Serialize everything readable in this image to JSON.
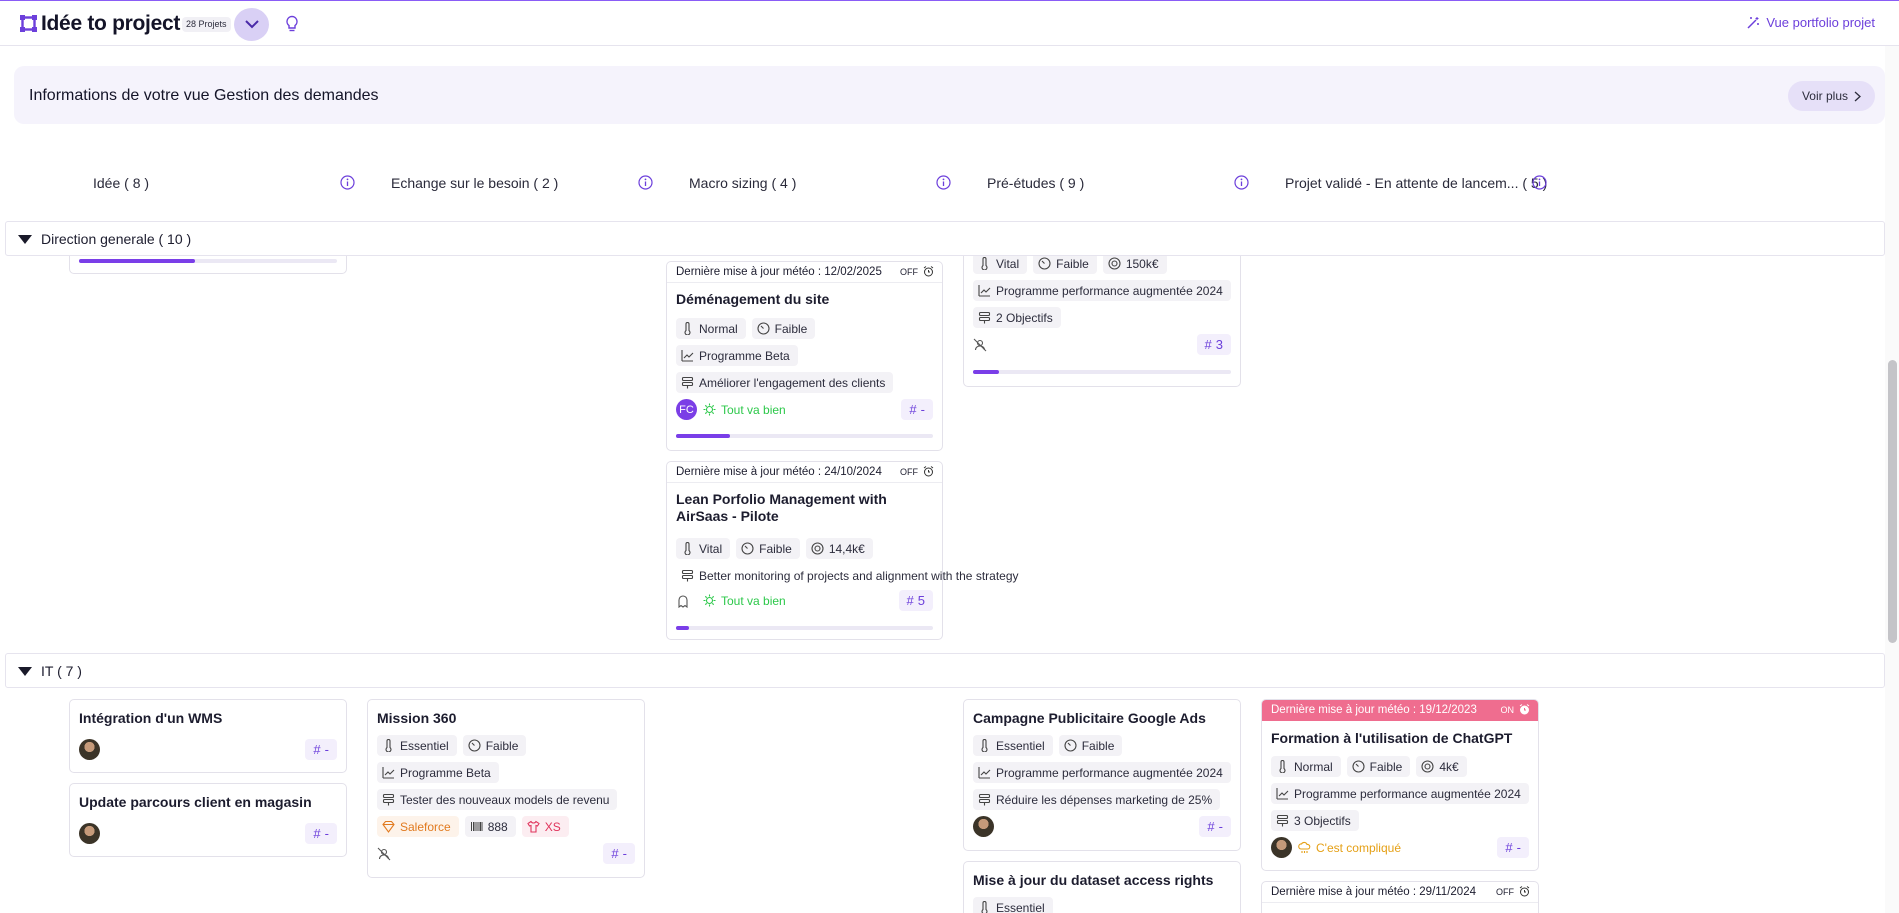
{
  "app": {
    "title": "Idée to project",
    "projects_count": "28 Projets",
    "portfolio_link": "Vue portfolio projet"
  },
  "banner": {
    "title": "Informations de votre vue Gestion des demandes",
    "more": "Voir plus"
  },
  "columns": [
    {
      "title": "Idée ( 8 )"
    },
    {
      "title": "Echange sur le besoin ( 2 )"
    },
    {
      "title": "Macro sizing ( 4 )"
    },
    {
      "title": "Pré-études ( 9 )"
    },
    {
      "title": "Projet validé - En attente de lancem... ( 5 )"
    }
  ],
  "groups": [
    {
      "label": "Direction generale ( 10 )"
    },
    {
      "label": "IT ( 7 )"
    }
  ],
  "cards": {
    "demenagement": {
      "meteo": "Dernière mise à jour météo : 12/02/2025",
      "toggle": "OFF",
      "title": "Déménagement du site",
      "tags": [
        "Normal",
        "Faible"
      ],
      "program": "Programme Beta",
      "objective": "Améliorer l'engagement des clients",
      "owner": "FC",
      "mood": "Tout va bien",
      "hash": "-",
      "progress": 0.21
    },
    "lean": {
      "meteo": "Dernière mise à jour météo : 24/10/2024",
      "toggle": "OFF",
      "title": "Lean Porfolio Management with AirSaas - Pilote",
      "tags": [
        "Vital",
        "Faible",
        "14,4k€"
      ],
      "objective": "Better monitoring of projects and alignment with the strategy",
      "mood": "Tout va bien",
      "hash": "5",
      "progress": 0.05
    },
    "pre_etude_top": {
      "tags": [
        "Vital",
        "Faible",
        "150k€"
      ],
      "program": "Programme performance augmentée 2024",
      "objective": "2 Objectifs",
      "hash": "3",
      "progress": 0.1
    },
    "idee_top": {
      "progress": 0.45
    },
    "wms": {
      "title": "Intégration d'un WMS",
      "hash": "-"
    },
    "parcours": {
      "title": "Update parcours client en magasin",
      "hash": "-"
    },
    "mission360": {
      "title": "Mission 360",
      "tags": [
        "Essentiel",
        "Faible"
      ],
      "program": "Programme Beta",
      "objective": "Tester des nouveaux models de revenu",
      "extra": [
        "Saleforce",
        "888",
        "XS"
      ],
      "hash": "-"
    },
    "google_ads": {
      "title": "Campagne Publicitaire Google Ads",
      "tags": [
        "Essentiel",
        "Faible"
      ],
      "program": "Programme performance augmentée 2024",
      "objective": "Réduire les dépenses marketing de 25%",
      "hash": "-"
    },
    "dataset": {
      "title": "Mise à jour du dataset access rights",
      "tags": [
        "Essentiel"
      ]
    },
    "chatgpt": {
      "meteo": "Dernière mise à jour météo : 19/12/2023",
      "toggle": "ON",
      "title": "Formation à l'utilisation de ChatGPT",
      "tags": [
        "Normal",
        "Faible",
        "4k€"
      ],
      "program": "Programme performance augmentée 2024",
      "objective": "3 Objectifs",
      "mood": "C'est compliqué",
      "hash": "-"
    },
    "last": {
      "meteo": "Dernière mise à jour météo : 29/11/2024",
      "toggle": "OFF"
    }
  },
  "colors": {
    "accent": "#6c3fdb",
    "progress": "#7a3ee8",
    "ok": "#2cc84a",
    "warn": "#e5a016",
    "on_header": "#ef6d8f"
  }
}
